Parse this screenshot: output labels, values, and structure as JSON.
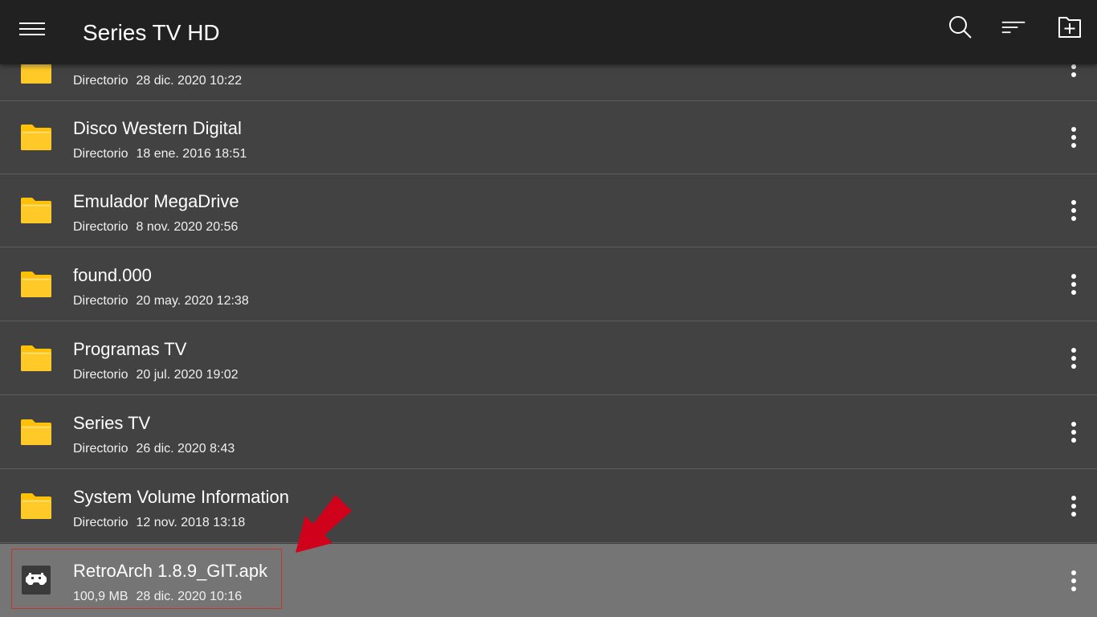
{
  "appbar": {
    "title": "Series TV HD",
    "icons": [
      "menu-icon",
      "search-icon",
      "sort-icon",
      "new-folder-icon"
    ]
  },
  "items": [
    {
      "name": "",
      "type": "Directorio",
      "date": "28 dic. 2020 10:22",
      "icon": "folder-icon"
    },
    {
      "name": "Disco Western Digital",
      "type": "Directorio",
      "date": "18 ene. 2016 18:51",
      "icon": "folder-icon"
    },
    {
      "name": "Emulador MegaDrive",
      "type": "Directorio",
      "date": "8 nov. 2020 20:56",
      "icon": "folder-icon"
    },
    {
      "name": "found.000",
      "type": "Directorio",
      "date": "20 may. 2020 12:38",
      "icon": "folder-icon"
    },
    {
      "name": "Programas TV",
      "type": "Directorio",
      "date": "20 jul. 2020 19:02",
      "icon": "folder-icon"
    },
    {
      "name": "Series TV",
      "type": "Directorio",
      "date": "26 dic. 2020 8:43",
      "icon": "folder-icon"
    },
    {
      "name": "System Volume Information",
      "type": "Directorio",
      "date": "12 nov. 2018 13:18",
      "icon": "folder-icon"
    },
    {
      "name": "RetroArch 1.8.9_GIT.apk",
      "type": "100,9 MB",
      "date": "28 dic. 2020 10:16",
      "icon": "retroarch-app-icon",
      "selected": true
    }
  ],
  "colors": {
    "appbar": "#212121",
    "background": "#424242",
    "selected_row": "#757575",
    "folder": "#FFCA28",
    "annotation": "#D0021B"
  }
}
